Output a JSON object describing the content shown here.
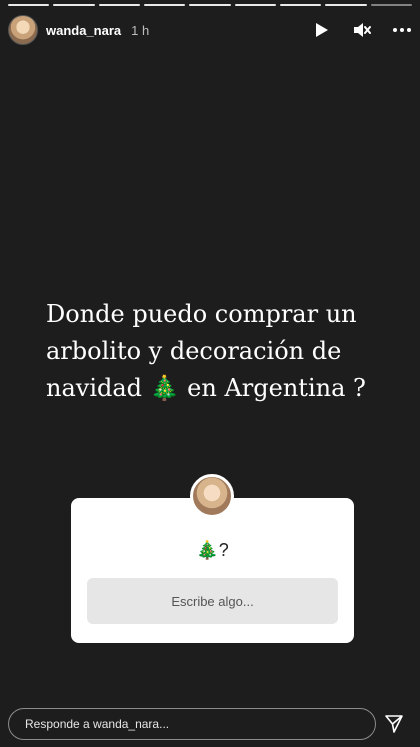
{
  "story": {
    "segments_total": 9,
    "segments_done": 8,
    "user": {
      "username": "wanda_nara",
      "time": "1 h"
    },
    "question_text": "Donde puedo comprar un arbolito y decoración de navidad 🎄 en Argentina ?"
  },
  "question_box": {
    "prompt": "🎄?",
    "input_placeholder": "Escribe algo..."
  },
  "reply": {
    "placeholder": "Responde a wanda_nara..."
  },
  "icons": {
    "play": "play-icon",
    "mute": "speaker-muted-icon",
    "more": "more-horizontal-icon",
    "send": "paper-plane-icon"
  }
}
